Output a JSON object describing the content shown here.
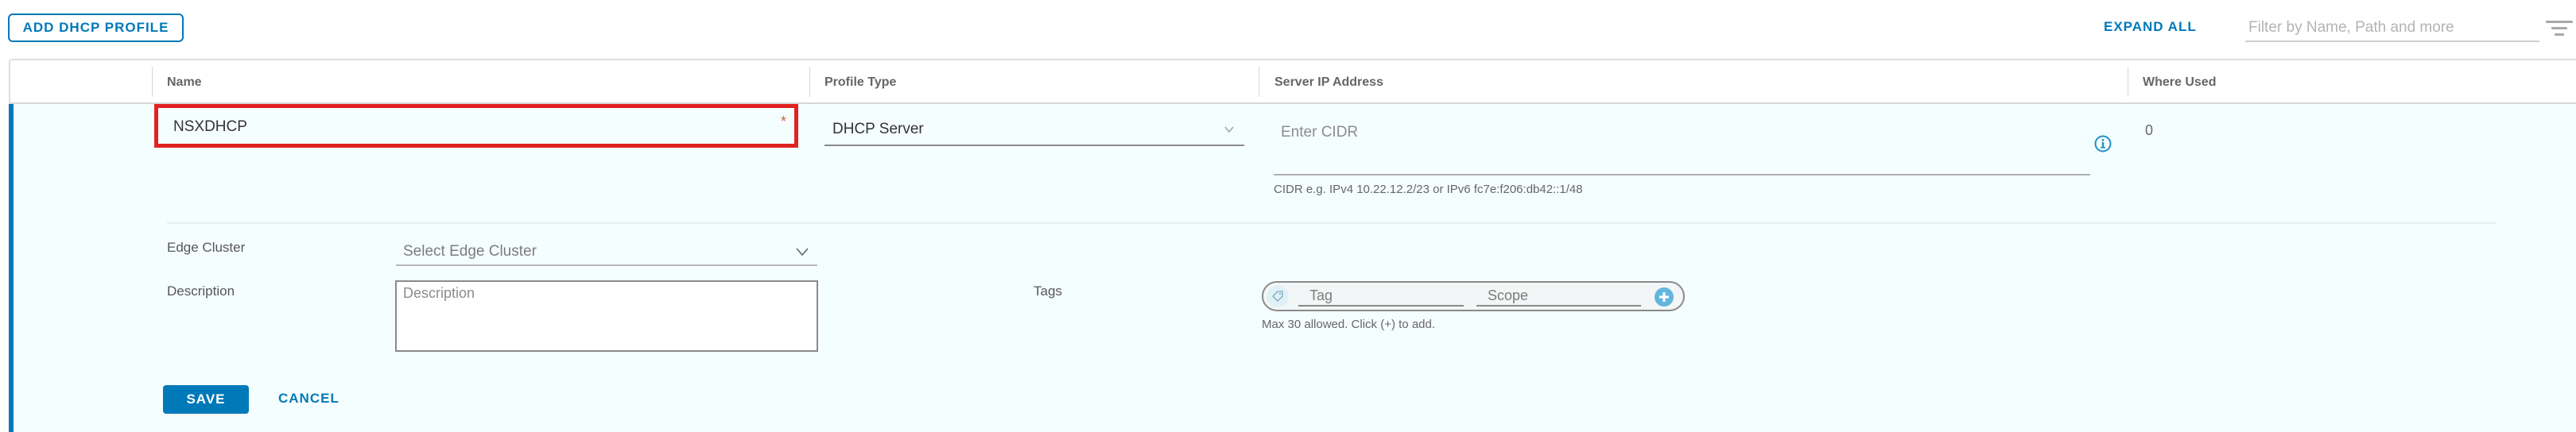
{
  "toolbar": {
    "add_button_label": "ADD DHCP PROFILE",
    "expand_all_label": "EXPAND ALL",
    "filter_placeholder": "Filter by Name, Path and more",
    "filter_icon": "filter-icon"
  },
  "table": {
    "columns": [
      {
        "label": ""
      },
      {
        "label": "Name"
      },
      {
        "label": "Profile Type"
      },
      {
        "label": "Server IP Address"
      },
      {
        "label": "Where Used"
      }
    ]
  },
  "editor": {
    "name": {
      "value": "NSXDHCP",
      "required_marker": "*",
      "highlighted": true
    },
    "profile_type": {
      "value": "DHCP Server"
    },
    "server_ip": {
      "placeholder": "Enter CIDR",
      "value": "",
      "hint": "CIDR e.g. IPv4 10.22.12.2/23 or IPv6 fc7e:f206:db42::1/48",
      "info_icon": "info-icon"
    },
    "where_used": "0",
    "edge_cluster": {
      "label": "Edge Cluster",
      "placeholder": "Select Edge Cluster"
    },
    "description": {
      "label": "Description",
      "placeholder": "Description",
      "value": ""
    },
    "tags": {
      "label": "Tags",
      "tag_placeholder": "Tag",
      "scope_placeholder": "Scope",
      "hint": "Max 30 allowed. Click (+) to add."
    },
    "save_label": "SAVE",
    "cancel_label": "CANCEL"
  },
  "colors": {
    "accent": "#0079b8",
    "highlight": "#e12222",
    "row_bg": "#f5feff",
    "required": "#d75b3a"
  }
}
